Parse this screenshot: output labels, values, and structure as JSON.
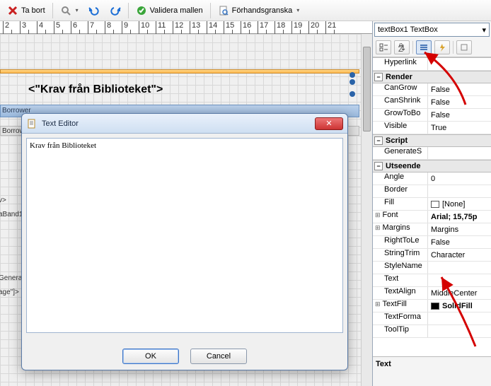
{
  "toolbar": {
    "remove": "Ta bort",
    "validate": "Validera mallen",
    "preview": "Förhandsgranska"
  },
  "ruler": {
    "min": 2,
    "max": 21
  },
  "canvas": {
    "textbox": "<\"Krav från Biblioteket\">",
    "band_header": "Borrower",
    "band_group": "Borrowe",
    "labels": {
      "l1": "v>",
      "l2": "aBand1",
      "l3": "General",
      "l4": "age\"]>"
    }
  },
  "editor": {
    "title": "Text Editor",
    "value": "Krav från Biblioteket",
    "ok": "OK",
    "cancel": "Cancel"
  },
  "props": {
    "selected": "textBox1 TextBox",
    "categories": [
      {
        "name": "",
        "rows": [
          {
            "k": "Hyperlink",
            "v": ""
          }
        ]
      },
      {
        "name": "Render",
        "rows": [
          {
            "k": "CanGrow",
            "v": "False"
          },
          {
            "k": "CanShrink",
            "v": "False"
          },
          {
            "k": "GrowToBo",
            "v": "False"
          },
          {
            "k": "Visible",
            "v": "True"
          }
        ]
      },
      {
        "name": "Script",
        "rows": [
          {
            "k": "GenerateS",
            "v": ""
          }
        ]
      },
      {
        "name": "Utseende",
        "rows": [
          {
            "k": "Angle",
            "v": "0"
          },
          {
            "k": "Border",
            "v": ""
          },
          {
            "k": "Fill",
            "v": "[None]",
            "sw": "#ffffff"
          },
          {
            "k": "Font",
            "v": "Arial; 15,75p",
            "bold": true,
            "plus": true
          },
          {
            "k": "Margins",
            "v": "Margins",
            "plus": true
          },
          {
            "k": "RightToLe",
            "v": "False"
          },
          {
            "k": "StringTrim",
            "v": "Character"
          },
          {
            "k": "StyleName",
            "v": ""
          },
          {
            "k": "Text",
            "v": ""
          },
          {
            "k": "TextAlign",
            "v": "MiddleCenter"
          },
          {
            "k": "TextFill",
            "v": "SolidFill",
            "bold": true,
            "plus": true,
            "sw": "#000000"
          },
          {
            "k": "TextForma",
            "v": ""
          },
          {
            "k": "ToolTip",
            "v": ""
          }
        ]
      }
    ],
    "description": "Text"
  }
}
